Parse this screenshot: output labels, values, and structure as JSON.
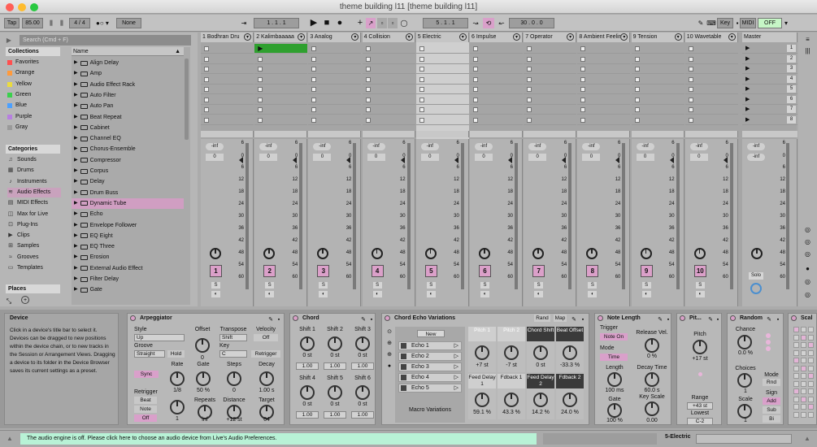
{
  "window": {
    "title": "theme building l11  [theme building l11]"
  },
  "control_bar": {
    "tap": "Tap",
    "tempo": "85.00",
    "time_sig": "4 / 4",
    "metronome": "None",
    "position": "1 . 1 . 1",
    "loop_start": "5 . 1 . 1",
    "loop_length": "30 . 0 . 0",
    "key_label": "Key",
    "midi_label": "MIDI",
    "cpu": "OFF"
  },
  "browser": {
    "search_placeholder": "Search (Cmd + F)",
    "collections_title": "Collections",
    "collections": [
      {
        "label": "Favorites",
        "color": "#ff4f4f"
      },
      {
        "label": "Orange",
        "color": "#ff9a3c"
      },
      {
        "label": "Yellow",
        "color": "#eadb3e"
      },
      {
        "label": "Green",
        "color": "#3ad04c"
      },
      {
        "label": "Blue",
        "color": "#4ba0ff"
      },
      {
        "label": "Purple",
        "color": "#b77fe0"
      },
      {
        "label": "Gray",
        "color": "#9a9a9a"
      }
    ],
    "categories_title": "Categories",
    "categories": [
      {
        "label": "Sounds",
        "icon": "sound-icon"
      },
      {
        "label": "Drums",
        "icon": "drums-icon"
      },
      {
        "label": "Instruments",
        "icon": "instruments-icon"
      },
      {
        "label": "Audio Effects",
        "icon": "audio-effects-icon",
        "selected": true
      },
      {
        "label": "MIDI Effects",
        "icon": "midi-effects-icon"
      },
      {
        "label": "Max for Live",
        "icon": "max-icon"
      },
      {
        "label": "Plug-Ins",
        "icon": "plugin-icon"
      },
      {
        "label": "Clips",
        "icon": "clips-icon"
      },
      {
        "label": "Samples",
        "icon": "samples-icon"
      },
      {
        "label": "Grooves",
        "icon": "grooves-icon"
      },
      {
        "label": "Templates",
        "icon": "templates-icon"
      }
    ],
    "places_title": "Places",
    "name_header": "Name",
    "items": [
      "Align Delay",
      "Amp",
      "Audio Effect Rack",
      "Auto Filter",
      "Auto Pan",
      "Beat Repeat",
      "Cabinet",
      "Channel EQ",
      "Chorus-Ensemble",
      "Compressor",
      "Corpus",
      "Delay",
      "Drum Buss",
      "Dynamic Tube",
      "Echo",
      "Envelope Follower",
      "EQ Eight",
      "EQ Three",
      "Erosion",
      "External Audio Effect",
      "Filter Delay",
      "Gate"
    ],
    "selected_item": "Dynamic Tube"
  },
  "tracks": [
    {
      "name": "1 Bodhran Dru",
      "num": "1",
      "color": "#dba0c9"
    },
    {
      "name": "2 Kalimbaaaaa",
      "num": "2",
      "color": "#dba0c9",
      "playing": true
    },
    {
      "name": "3 Analog",
      "num": "3",
      "color": "#dba0c9"
    },
    {
      "name": "4 Collision",
      "num": "4",
      "color": "#dba0c9"
    },
    {
      "name": "5 Electric",
      "num": "5",
      "color": "#dba0c9",
      "selected": true
    },
    {
      "name": "6 Impulse",
      "num": "6",
      "color": "#dba0c9"
    },
    {
      "name": "7 Operator",
      "num": "7",
      "color": "#dba0c9"
    },
    {
      "name": "8 Ambient Feelin",
      "num": "8",
      "color": "#dba0c9"
    },
    {
      "name": "9 Tension",
      "num": "9",
      "color": "#dba0c9"
    },
    {
      "name": "10 Wavetable",
      "num": "10",
      "color": "#dba0c9"
    }
  ],
  "master": {
    "name": "Master",
    "scenes": [
      "1",
      "2",
      "3",
      "4",
      "5",
      "6",
      "7",
      "8"
    ],
    "solo": "Solo"
  },
  "mixer": {
    "vol": "-inf",
    "pan": "0",
    "scale": [
      "6",
      "0",
      "6",
      "12",
      "18",
      "24",
      "30",
      "36",
      "42",
      "48",
      "54",
      "60"
    ],
    "s_label": "S"
  },
  "info": {
    "title": "Device",
    "text": "Click in a device's title bar to select it. Devices can be dragged to new positions within the device chain, or to new tracks in the Session or Arrangement Views. Dragging a device to its folder in the Device Browser saves its current settings as a preset."
  },
  "arpeggiator": {
    "title": "Arpeggiator",
    "style_label": "Style",
    "style": "Up",
    "groove_label": "Groove",
    "groove": "Straight",
    "hold": "Hold",
    "offset_label": "Offset",
    "offset": "0",
    "transpose_label": "Transpose",
    "transpose": "Shift",
    "velocity_label": "Velocity",
    "velocity_state": "Off",
    "key_label": "Key",
    "key": "C",
    "retrigger_btn": "Retrigger",
    "sync": "Sync",
    "rate_label": "Rate",
    "rate": "1/8",
    "gate_label": "Gate",
    "gate": "50 %",
    "steps_label": "Steps",
    "steps": "0",
    "decay_label": "Decay",
    "decay": "1.00 s",
    "retrigger_label": "Retrigger",
    "retrig_beat": "Beat",
    "retrig_note": "Note",
    "retrig_off": "Off",
    "retrig_val": "1",
    "repeats_label": "Repeats",
    "repeats": "inf",
    "distance_label": "Distance",
    "distance": "+12 st",
    "target_label": "Target",
    "target": "64"
  },
  "chord": {
    "title": "Chord",
    "shifts": [
      {
        "label": "Shift 1",
        "val": "0 st",
        "vel": "1.00"
      },
      {
        "label": "Shift 2",
        "val": "0 st",
        "vel": "1.00"
      },
      {
        "label": "Shift 3",
        "val": "0 st",
        "vel": "1.00"
      },
      {
        "label": "Shift 4",
        "val": "0 st",
        "vel": "1.00"
      },
      {
        "label": "Shift 5",
        "val": "0 st",
        "vel": "1.00"
      },
      {
        "label": "Shift 6",
        "val": "0 st",
        "vel": "1.00"
      }
    ]
  },
  "chord_echo": {
    "title": "Chord Echo Variations",
    "rand": "Rand",
    "map": "Map",
    "new": "New",
    "echoes": [
      "Echo 1",
      "Echo 2",
      "Echo 3",
      "Echo 4",
      "Echo 5"
    ],
    "macro_label": "Macro Variations",
    "macros": [
      {
        "label": "Pitch 1",
        "val": "+7 st"
      },
      {
        "label": "Pitch 2",
        "val": "-7 st"
      },
      {
        "label": "Chord Shift",
        "val": "0 st"
      },
      {
        "label": "Beat Offset",
        "val": "-33.3 %"
      },
      {
        "label": "Feed Delay 1",
        "val": "59.1 %"
      },
      {
        "label": "Fdback 1",
        "val": "43.3 %"
      },
      {
        "label": "Feed Delay 2",
        "val": "14.2 %"
      },
      {
        "label": "Fdback 2",
        "val": "24.0 %"
      }
    ]
  },
  "note_length": {
    "title": "Note Length",
    "trigger_label": "Trigger",
    "trigger": "Note On",
    "mode_label": "Mode",
    "mode": "Time",
    "release_label": "Release Vel.",
    "release": "0 %",
    "length_label": "Length",
    "length": "100 ms",
    "decay_label": "Decay Time",
    "decay": "60.0 s",
    "gate_label": "Gate",
    "gate": "100 %",
    "keyscale_label": "Key Scale",
    "keyscale": "0.00"
  },
  "pitch": {
    "title": "Pit...",
    "pitch_label": "Pitch",
    "pitch": "+17 st",
    "range_label": "Range",
    "range": "+43 st",
    "lowest_label": "Lowest",
    "lowest": "C-2"
  },
  "random": {
    "title": "Random",
    "chance_label": "Chance",
    "chance": "0.0 %",
    "choices_label": "Choices",
    "choices": "1",
    "scale_label": "Scale",
    "scale": "1",
    "mode_label": "Mode",
    "mode": "Rnd",
    "sign_label": "Sign",
    "sign_add": "Add",
    "sign_sub": "Sub",
    "sign_bi": "Bi"
  },
  "scale_dev": {
    "title": "Scal"
  },
  "status": {
    "message": "The audio engine is off. Please click here to choose an audio device from Live's Audio Preferences.",
    "track": "5-Electric"
  }
}
